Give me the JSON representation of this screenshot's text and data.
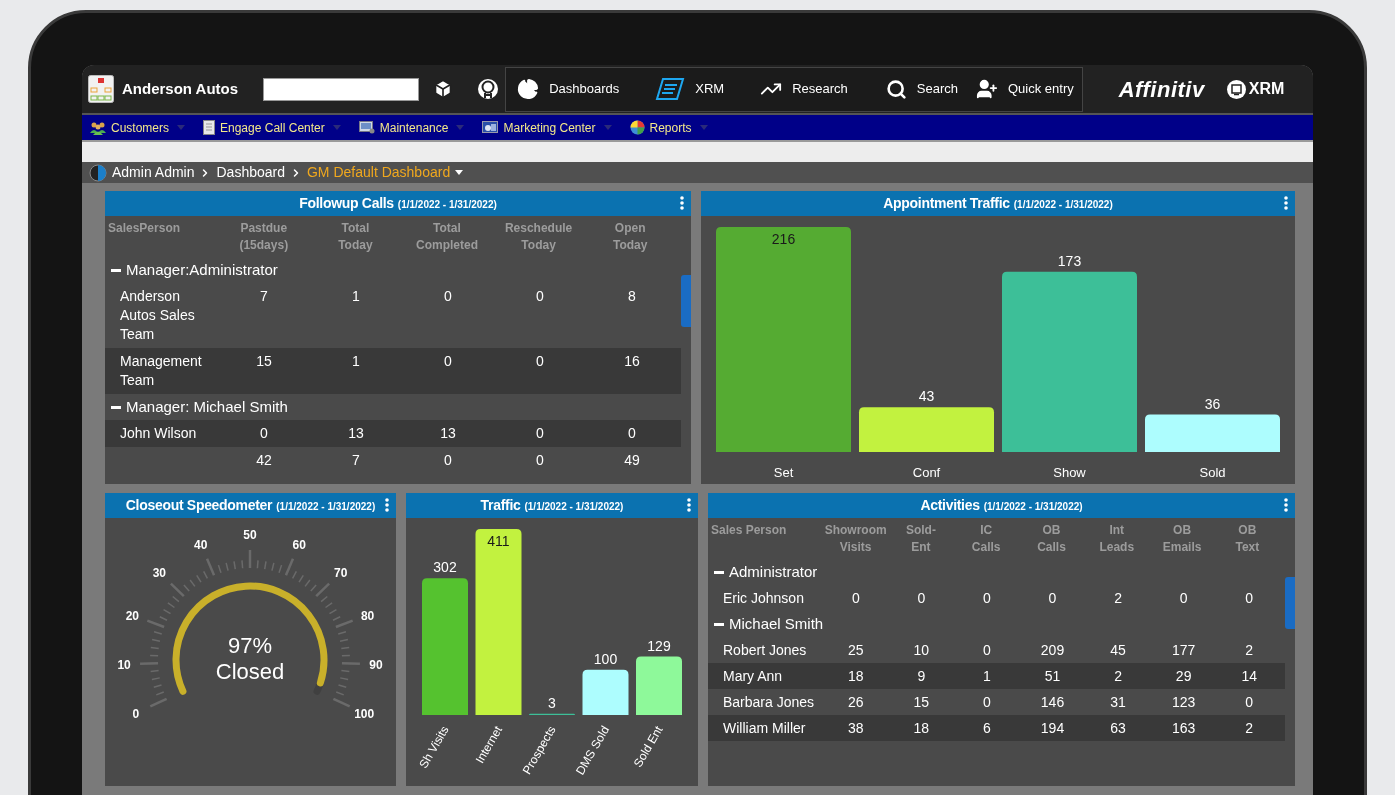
{
  "header": {
    "company": "Anderson Autos",
    "nav": [
      {
        "kind": "dashboards",
        "label": "Dashboards"
      },
      {
        "kind": "xrm",
        "label": "XRM"
      },
      {
        "kind": "research",
        "label": "Research"
      },
      {
        "kind": "search",
        "label": "Search"
      },
      {
        "kind": "quick_entry",
        "label": "Quick entry"
      }
    ],
    "brand": "Affinitiv",
    "brand_product": "XRM"
  },
  "menu": [
    {
      "kind": "customers",
      "label": "Customers"
    },
    {
      "kind": "call_center",
      "label": "Engage Call Center"
    },
    {
      "kind": "maintenance",
      "label": "Maintenance"
    },
    {
      "kind": "marketing",
      "label": "Marketing Center"
    },
    {
      "kind": "reports",
      "label": "Reports"
    }
  ],
  "breadcrumb": {
    "items": [
      "Admin Admin",
      "Dashboard"
    ],
    "current": "GM Default Dashboard"
  },
  "followup_calls": {
    "title": "Followup Calls",
    "date_range": "(1/1/2022 - 1/31/2022)",
    "columns": [
      "SalesPerson",
      "Pastdue (15days)",
      "Total Today",
      "Total Completed",
      "Reschedule Today",
      "Open Today"
    ],
    "rows": [
      {
        "kind": "group",
        "label": "Manager:Administrator"
      },
      {
        "kind": "person",
        "name": "Anderson Autos Sales Team",
        "values": [
          "7",
          "1",
          "0",
          "0",
          "8"
        ]
      },
      {
        "kind": "person",
        "name": "Management Team",
        "values": [
          "15",
          "1",
          "0",
          "0",
          "16"
        ]
      },
      {
        "kind": "group",
        "label": "Manager: Michael Smith"
      },
      {
        "kind": "person",
        "name": "John Wilson",
        "values": [
          "0",
          "13",
          "13",
          "0",
          "0"
        ]
      },
      {
        "kind": "person",
        "values": [
          "42",
          "7",
          "0",
          "0",
          "49"
        ]
      }
    ]
  },
  "appointment_traffic": {
    "title": "Appointment Traffic",
    "date_range": "(1/1/2022 - 1/31/2022)",
    "chart_data": {
      "type": "bar",
      "categories": [
        "Set",
        "Conf",
        "Show",
        "Sold"
      ],
      "values": [
        216,
        43,
        173,
        36
      ],
      "colors": [
        "#55ab32",
        "#c2f23f",
        "#3dbf98",
        "#adfdfe"
      ],
      "data_labels": true
    }
  },
  "closeout_speedometer": {
    "title": "Closeout Speedometer",
    "date_range": "(1/1/2022 - 1/31/2022)",
    "gauge": {
      "level": 0.97,
      "ticks": [
        "0",
        "10",
        "20",
        "30",
        "40",
        "50",
        "60",
        "70",
        "80",
        "90",
        "100"
      ],
      "value_label": "97%",
      "caption": "Closed"
    }
  },
  "traffic": {
    "title": "Traffic",
    "date_range": "(1/1/2022 - 1/31/2022)",
    "chart_data": {
      "type": "bar",
      "categories": [
        "Sh Visits",
        "Internet",
        "Prospects",
        "DMS Sold",
        "Sold Ent"
      ],
      "values": [
        302,
        411,
        3,
        100,
        129
      ],
      "colors": [
        "#55c22f",
        "#c2f23f",
        "#3dbf98",
        "#adfdfe",
        "#8ef99a"
      ],
      "data_labels": true
    }
  },
  "activities": {
    "title": "Activities",
    "date_range": "(1/1/2022 - 1/31/2022)",
    "columns": [
      "Sales Person",
      "Showroom Visits",
      "Sold-Ent",
      "IC Calls",
      "OB Calls",
      "Int Leads",
      "OB Emails",
      "OB Text"
    ],
    "rows": [
      {
        "kind": "group",
        "label": "Administrator"
      },
      {
        "kind": "person",
        "name": "Eric Johnson",
        "values": [
          "0",
          "0",
          "0",
          "0",
          "2",
          "0",
          "0"
        ]
      },
      {
        "kind": "group",
        "label": "Michael Smith"
      },
      {
        "kind": "person",
        "name": "Robert Jones",
        "values": [
          "25",
          "10",
          "0",
          "209",
          "45",
          "177",
          "2"
        ]
      },
      {
        "kind": "person",
        "name": "Mary Ann",
        "values": [
          "18",
          "9",
          "1",
          "51",
          "2",
          "29",
          "14"
        ]
      },
      {
        "kind": "person",
        "name": "Barbara Jones",
        "values": [
          "26",
          "15",
          "0",
          "146",
          "31",
          "123",
          "0"
        ]
      },
      {
        "kind": "person",
        "name": "William Miller",
        "values": [
          "38",
          "18",
          "6",
          "194",
          "63",
          "163",
          "2"
        ]
      }
    ]
  }
}
